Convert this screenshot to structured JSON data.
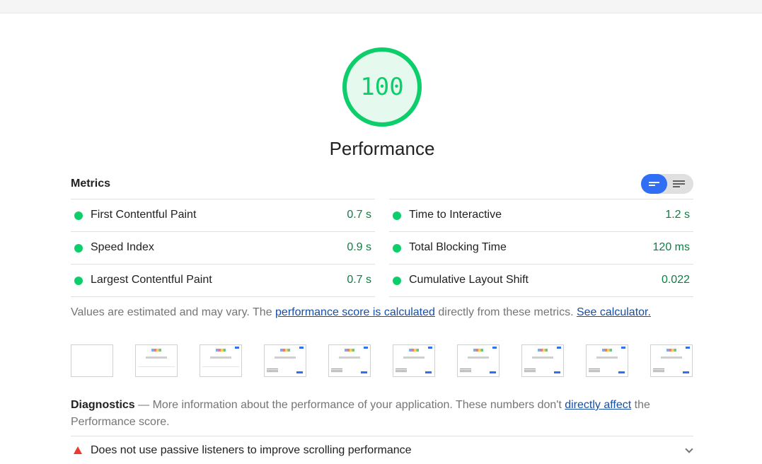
{
  "score": {
    "value": "100",
    "label": "Performance",
    "color": "#0cce6b"
  },
  "metrics": {
    "header": "Metrics",
    "view_toggle": {
      "active": "compact-view",
      "icons": [
        "compact-view-icon",
        "list-view-icon"
      ]
    },
    "left": [
      {
        "label": "First Contentful Paint",
        "value": "0.7 s",
        "status": "pass"
      },
      {
        "label": "Speed Index",
        "value": "0.9 s",
        "status": "pass"
      },
      {
        "label": "Largest Contentful Paint",
        "value": "0.7 s",
        "status": "pass"
      }
    ],
    "right": [
      {
        "label": "Time to Interactive",
        "value": "1.2 s",
        "status": "pass"
      },
      {
        "label": "Total Blocking Time",
        "value": "120 ms",
        "status": "pass"
      },
      {
        "label": "Cumulative Layout Shift",
        "value": "0.022",
        "status": "pass"
      }
    ]
  },
  "note": {
    "prefix": "Values are estimated and may vary. The ",
    "link1": "performance score is calculated",
    "middle": " directly from these metrics. ",
    "link2": "See calculator."
  },
  "diagnostics": {
    "title": "Diagnostics",
    "text_prefix": " — More information about the performance of your application. These numbers don't ",
    "link": "directly affect",
    "text_suffix": " the Performance score."
  },
  "audit": {
    "title": "Does not use passive listeners to improve scrolling performance",
    "icon": "warning-triangle-icon"
  }
}
